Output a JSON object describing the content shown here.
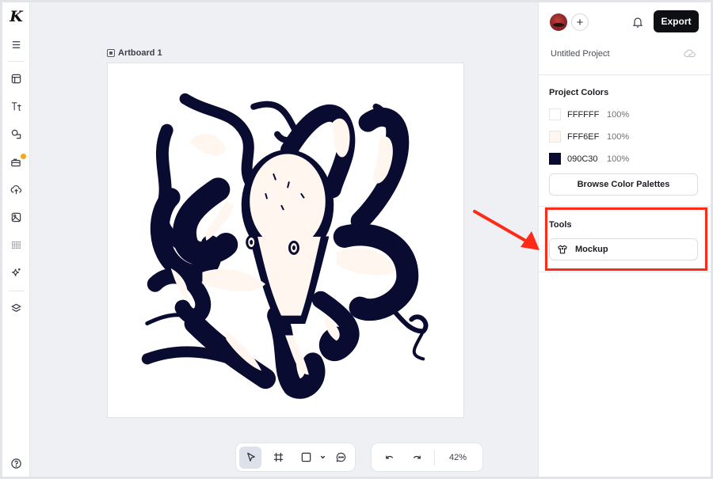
{
  "app": {
    "logo": "K"
  },
  "sidebar": {
    "items": [
      {
        "name": "menu",
        "icon": "hamburger-icon"
      },
      {
        "name": "templates",
        "icon": "layout-icon"
      },
      {
        "name": "text",
        "icon": "text-icon"
      },
      {
        "name": "elements",
        "icon": "shapes-icon"
      },
      {
        "name": "brand-kit",
        "icon": "briefcase-icon",
        "badge": true
      },
      {
        "name": "uploads",
        "icon": "upload-cloud-icon"
      },
      {
        "name": "photos",
        "icon": "image-icon"
      },
      {
        "name": "patterns",
        "icon": "dots-grid-icon"
      },
      {
        "name": "ai-tools",
        "icon": "sparkle-icon"
      },
      {
        "name": "layers",
        "icon": "layers-icon"
      }
    ],
    "help_icon": "help-circle-icon"
  },
  "canvas": {
    "artboard_label": "Artboard 1",
    "artwork": "octopus illustration",
    "artwork_colors": {
      "ink": "#090C30",
      "fill": "#FFF6EF",
      "background": "#FFFFFF"
    }
  },
  "toolbar": {
    "tools": [
      {
        "name": "select",
        "icon": "pointer-icon",
        "active": true
      },
      {
        "name": "frame",
        "icon": "hash-frame-icon"
      },
      {
        "name": "shape",
        "icon": "square-icon"
      },
      {
        "name": "comment",
        "icon": "comment-icon"
      }
    ],
    "undo_icon": "undo-icon",
    "redo_icon": "redo-icon",
    "zoom": "42%"
  },
  "panel": {
    "export_label": "Export",
    "project_name": "Untitled Project",
    "project_colors_title": "Project Colors",
    "colors": [
      {
        "hex": "FFFFFF",
        "opacity": "100%",
        "swatch": "#FFFFFF"
      },
      {
        "hex": "FFF6EF",
        "opacity": "100%",
        "swatch": "#FFF6EF"
      },
      {
        "hex": "090C30",
        "opacity": "100%",
        "swatch": "#090C30"
      }
    ],
    "browse_palettes_label": "Browse Color Palettes",
    "tools_title": "Tools",
    "mockup_label": "Mockup"
  },
  "annotation": {
    "color": "#FF2A17",
    "target": "Tools section"
  }
}
